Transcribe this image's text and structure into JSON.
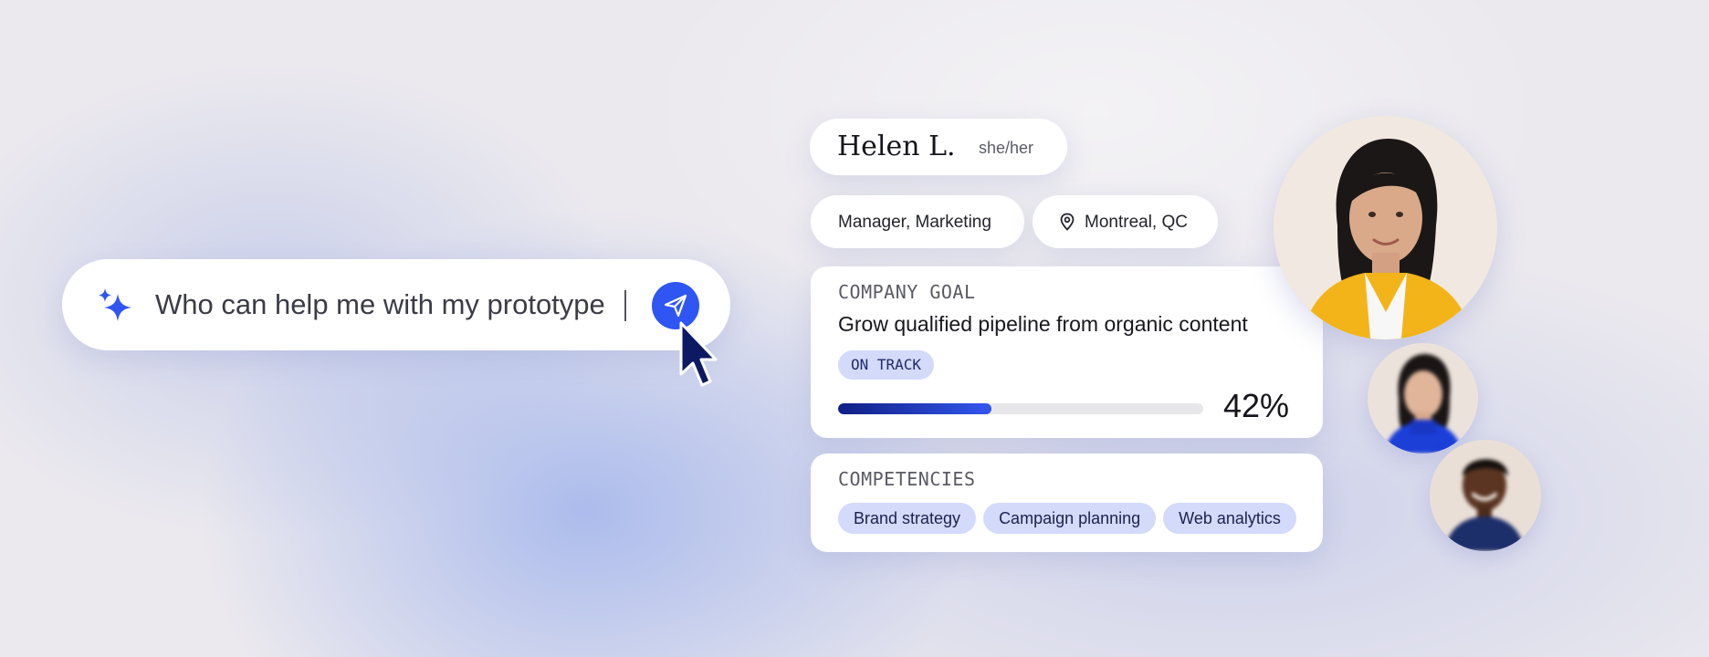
{
  "search": {
    "query": "Who can help me with my prototype",
    "send_label": "Send"
  },
  "profile": {
    "name": "Helen L.",
    "pronouns": "she/her",
    "role": "Manager, Marketing",
    "location": "Montreal, QC"
  },
  "goal": {
    "label": "COMPANY GOAL",
    "title": "Grow qualified pipeline from organic content",
    "status": "ON TRACK",
    "progress_percent": 42,
    "progress_text": "42%"
  },
  "competencies": {
    "label": "COMPETENCIES",
    "items": [
      "Brand strategy",
      "Campaign planning",
      "Web analytics"
    ]
  },
  "icons": {
    "search": "sparkle-icon",
    "send": "paper-plane-icon",
    "location": "map-pin-icon",
    "pointer": "mouse-cursor-icon"
  },
  "colors": {
    "accent": "#2f56f2",
    "chip": "#d3dafa",
    "progress_start": "#0f1f85",
    "progress_end": "#3256ee"
  }
}
